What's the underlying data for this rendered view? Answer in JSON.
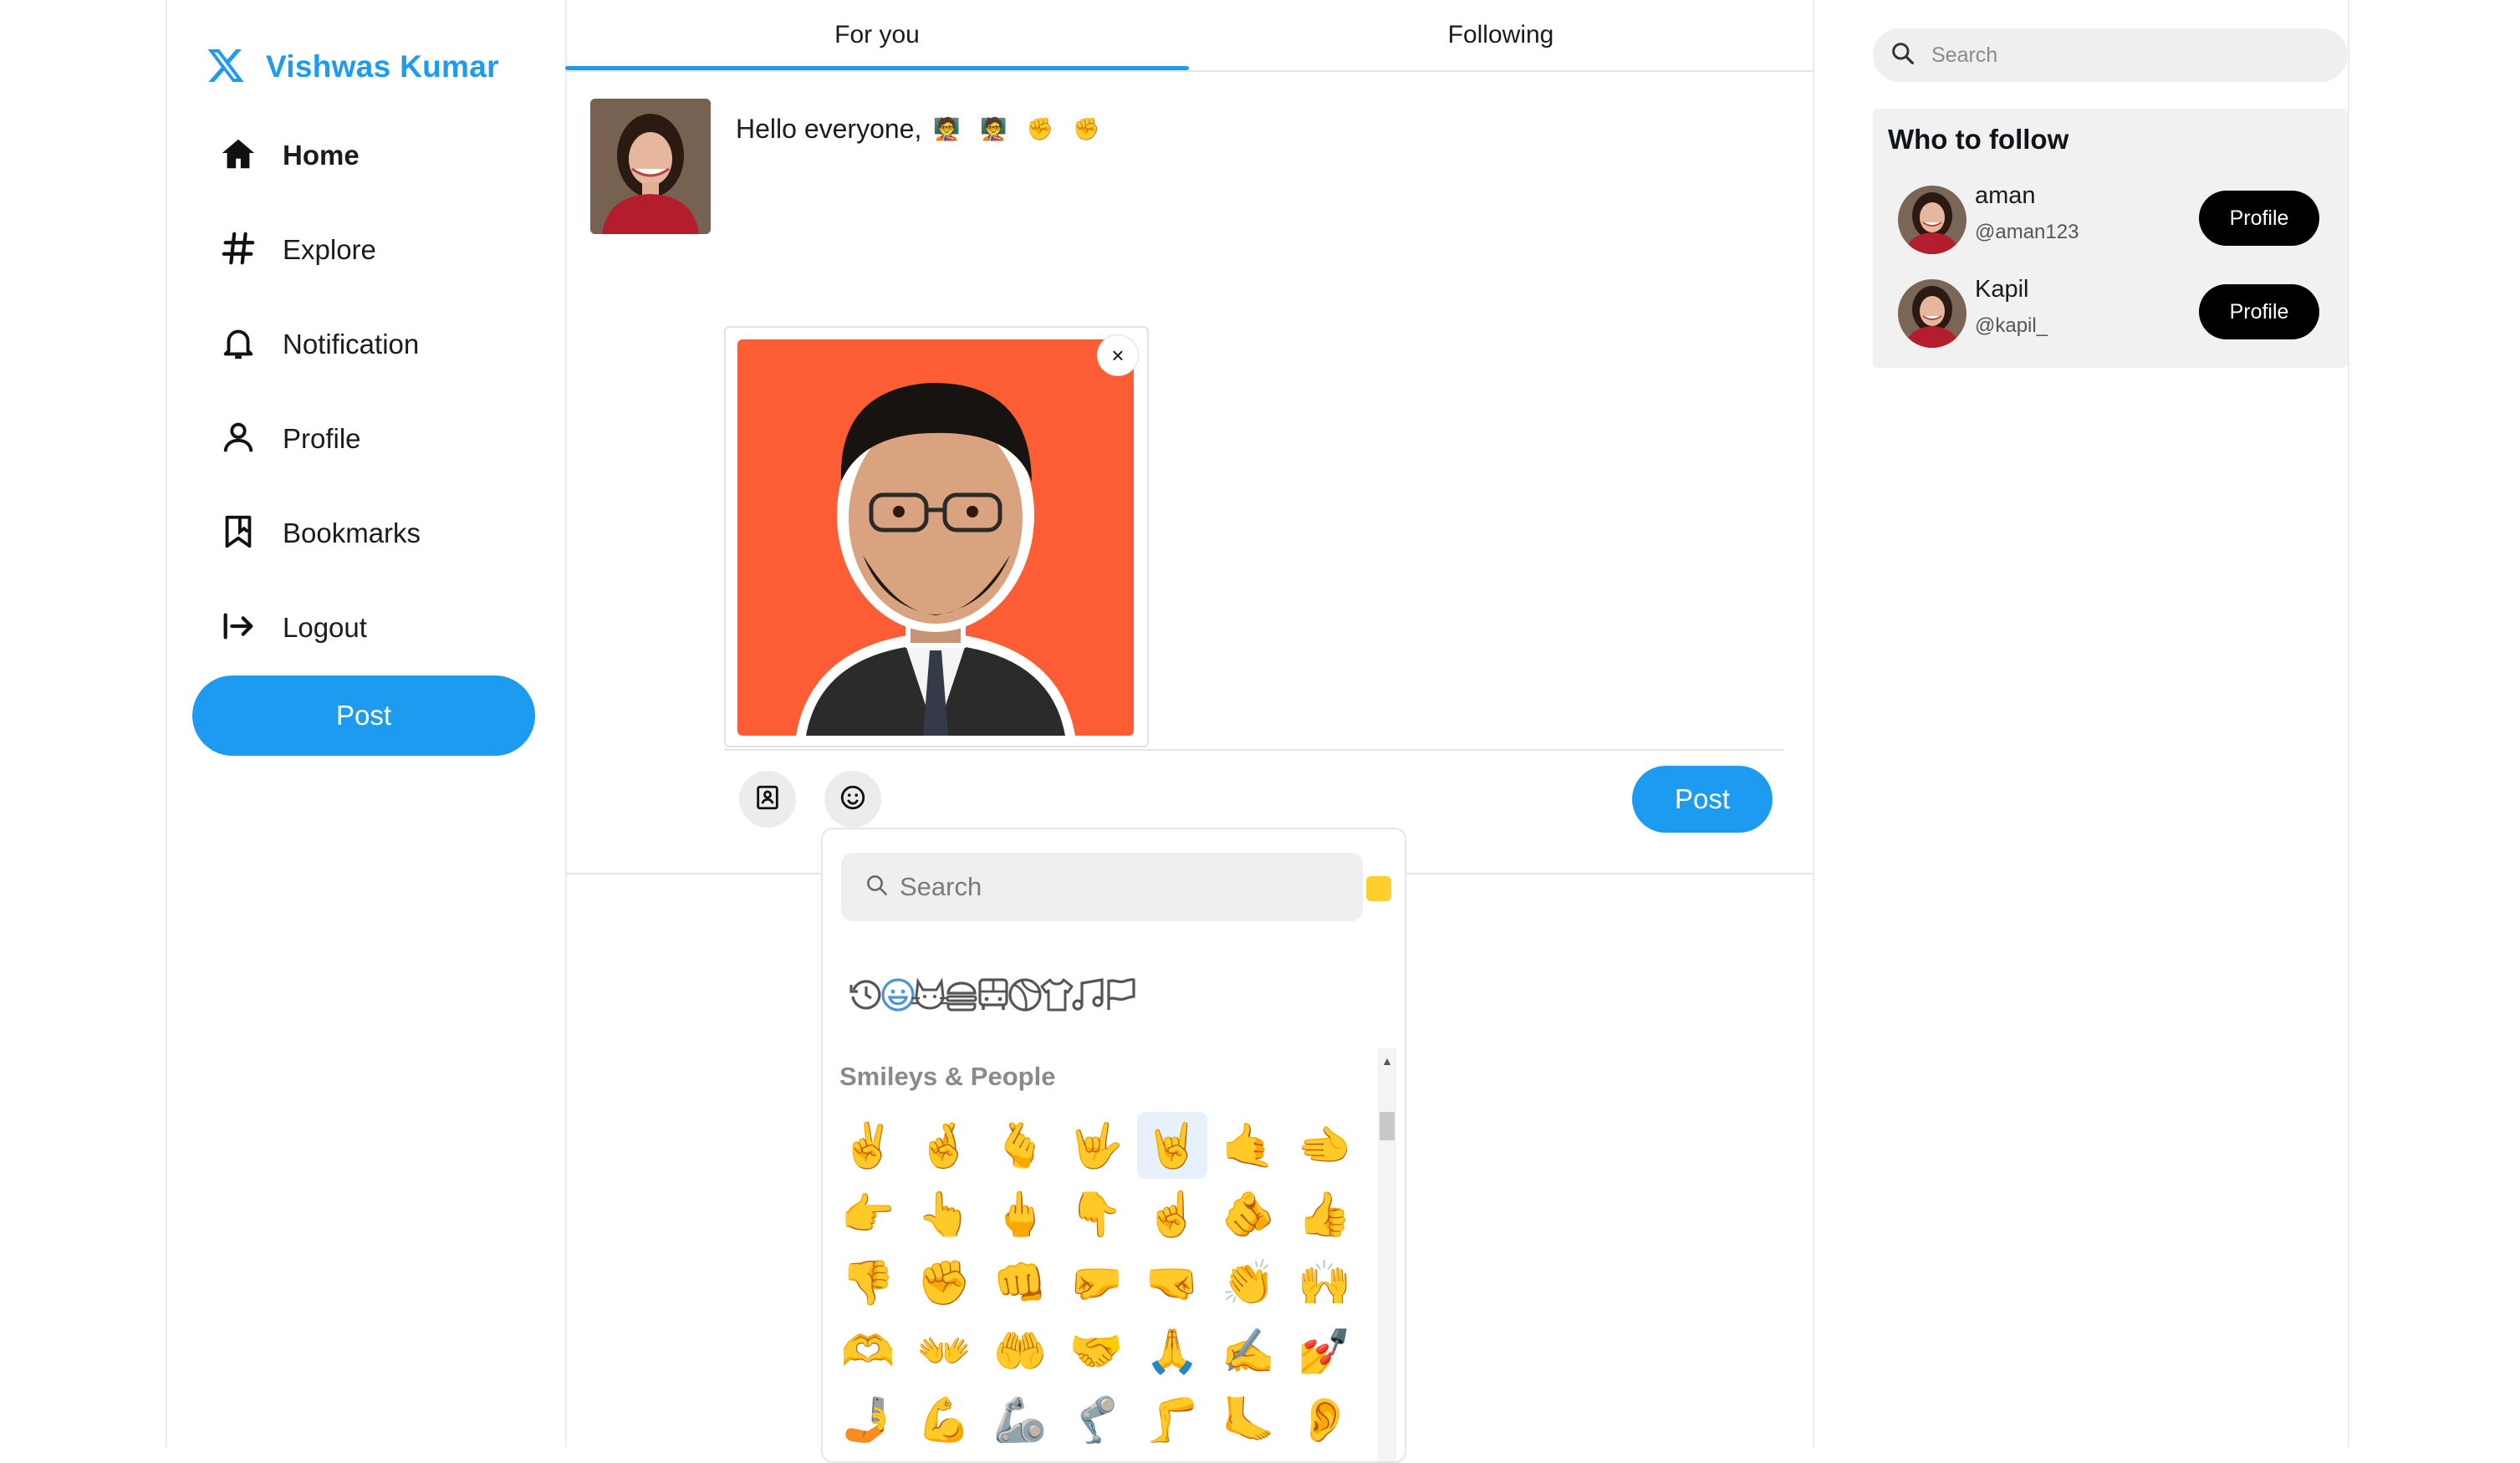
{
  "brand": {
    "name": "Vishwas Kumar",
    "icon": "x-logo-icon",
    "color": "#1d9bf0"
  },
  "nav": {
    "items": [
      {
        "label": "Home",
        "icon": "home-icon",
        "active": true
      },
      {
        "label": "Explore",
        "icon": "hashtag-icon"
      },
      {
        "label": "Notification",
        "icon": "bell-icon"
      },
      {
        "label": "Profile",
        "icon": "user-icon"
      },
      {
        "label": "Bookmarks",
        "icon": "bookmark-icon"
      },
      {
        "label": "Logout",
        "icon": "logout-icon"
      }
    ],
    "post_label": "Post"
  },
  "feed": {
    "tabs": [
      {
        "label": "For you",
        "active": true
      },
      {
        "label": "Following"
      }
    ]
  },
  "composer": {
    "text": "Hello everyone,",
    "emojis": "🧑‍🏫 🧑‍🏫 ✊ ✊",
    "remove_image_label": "×",
    "image_tool_icon": "image-icon",
    "emoji_tool_icon": "smiley-icon",
    "post_label": "Post"
  },
  "emoji_picker": {
    "search_placeholder": "Search",
    "skin_tone_color": "#ffcf30",
    "categories": [
      "recent-icon",
      "smileys-icon",
      "animals-icon",
      "food-icon",
      "travel-icon",
      "activity-icon",
      "objects-icon",
      "symbols-icon",
      "flags-icon"
    ],
    "active_category": "smileys-icon",
    "section_title": "Smileys & People",
    "emojis": [
      "✌️",
      "🤞",
      "🫰",
      "🤟",
      "🤘",
      "🤙",
      "🫲",
      "👉",
      "👆",
      "🖕",
      "👇",
      "☝️",
      "🫵",
      "👍",
      "👎",
      "✊",
      "👊",
      "🤛",
      "🤜",
      "👏",
      "🙌",
      "🫶",
      "👐",
      "🤲",
      "🤝",
      "🙏",
      "✍️",
      "💅",
      "🤳",
      "💪",
      "🦾",
      "🦿",
      "🦵",
      "🦶",
      "👂"
    ],
    "selected_index": 4
  },
  "right": {
    "search_placeholder": "Search",
    "who_to_follow_title": "Who to follow",
    "suggestions": [
      {
        "name": "aman",
        "handle": "@aman123",
        "button": "Profile"
      },
      {
        "name": "Kapil",
        "handle": "@kapil_",
        "button": "Profile"
      }
    ]
  }
}
